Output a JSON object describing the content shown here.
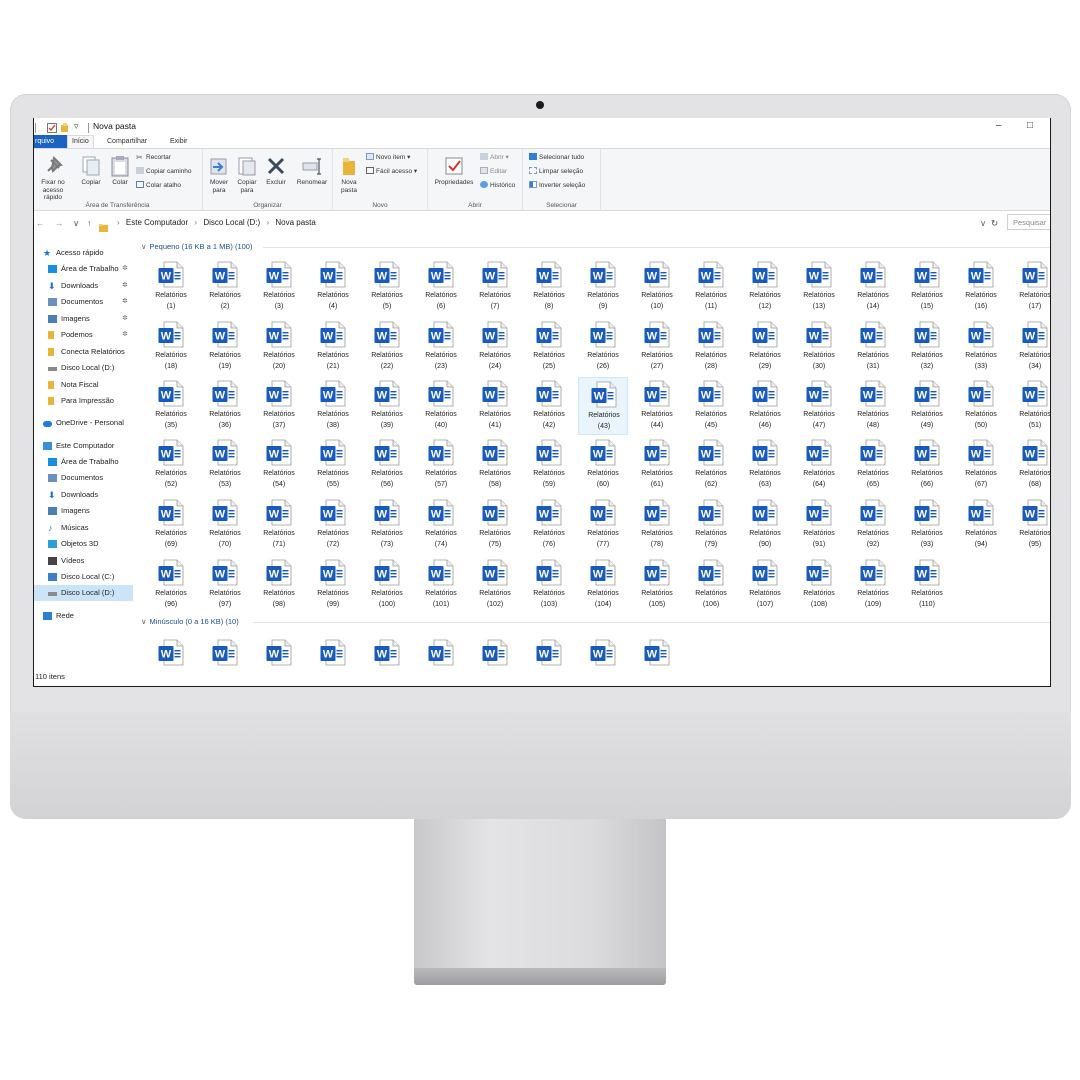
{
  "window": {
    "title": "Nova pasta",
    "minimize": "–",
    "maximize": "□"
  },
  "ribbon_tabs": [
    {
      "label": "rquivo"
    },
    {
      "label": "Início"
    },
    {
      "label": "Compartilhar"
    },
    {
      "label": "Exibir"
    }
  ],
  "ribbon": {
    "clipboard": {
      "pin_label": "Fixar no acesso rápido",
      "copy_label": "Copiar",
      "paste_label": "Colar",
      "cut_label": "Recortar",
      "copy_path_label": "Copiar caminho",
      "paste_shortcut_label": "Colar atalho",
      "group_label": "Área de Transferência"
    },
    "organize": {
      "move_label": "Mover para",
      "copy_label": "Copiar para",
      "delete_label": "Excluir",
      "rename_label": "Renomear",
      "group_label": "Organizar"
    },
    "new": {
      "new_folder_label": "Nova pasta",
      "new_item_label": "Novo item ▾",
      "easy_access_label": "Fácil acesso ▾",
      "group_label": "Novo"
    },
    "open": {
      "properties_label": "Propriedades",
      "open_label": "Abrir ▾",
      "edit_label": "Editar",
      "history_label": "Histórico",
      "group_label": "Abrir"
    },
    "select": {
      "select_all_label": "Selecionar tudo",
      "select_none_label": "Limpar seleção",
      "invert_label": "Inverter seleção",
      "group_label": "Selecionar"
    }
  },
  "address": {
    "crumbs": [
      "Este Computador",
      "Disco Local (D:)",
      "Nova pasta"
    ],
    "search_placeholder": "Pesquisar",
    "back": "←",
    "forward": "→",
    "recent": "∨",
    "up": "↑",
    "refresh": "↻",
    "dropdown": "∨"
  },
  "nav_pane": {
    "items": [
      {
        "label": "Acesso rápido",
        "icon": "star-icon",
        "color": "#1f6fd0",
        "pinned": false
      },
      {
        "label": "Área de Trabalho",
        "icon": "desktop-icon",
        "color": "#1a8fe0",
        "pinned": true
      },
      {
        "label": "Downloads",
        "icon": "download-icon",
        "color": "#1a6fd0",
        "pinned": true
      },
      {
        "label": "Documentos",
        "icon": "documents-icon",
        "color": "#6b8fbf",
        "pinned": true
      },
      {
        "label": "Imagens",
        "icon": "pictures-icon",
        "color": "#4a7fb5",
        "pinned": true
      },
      {
        "label": "Podemos",
        "icon": "folder-icon",
        "color": "#e8b43a",
        "pinned": true
      },
      {
        "label": "Conecta Relatórios",
        "icon": "folder-icon",
        "color": "#e8b43a",
        "pinned": false
      },
      {
        "label": "Disco Local (D:)",
        "icon": "drive-icon",
        "color": "#8a8a8a",
        "pinned": false
      },
      {
        "label": "Nota Fiscal",
        "icon": "folder-icon",
        "color": "#e8b43a",
        "pinned": false
      },
      {
        "label": "Para Impressão",
        "icon": "folder-icon",
        "color": "#e8b43a",
        "pinned": false
      },
      {
        "label": "OneDrive - Personal",
        "icon": "cloud-icon",
        "color": "#1a7fd8",
        "pinned": false
      },
      {
        "label": "Este Computador",
        "icon": "computer-icon",
        "color": "#3a8fd8",
        "pinned": false
      },
      {
        "label": "Área de Trabalho",
        "icon": "desktop-icon",
        "color": "#1a8fe0",
        "pinned": false
      },
      {
        "label": "Documentos",
        "icon": "documents-icon",
        "color": "#6b8fbf",
        "pinned": false
      },
      {
        "label": "Downloads",
        "icon": "download-icon",
        "color": "#1a6fd0",
        "pinned": false
      },
      {
        "label": "Imagens",
        "icon": "pictures-icon",
        "color": "#4a7fb5",
        "pinned": false
      },
      {
        "label": "Músicas",
        "icon": "music-icon",
        "color": "#2a6fc8",
        "pinned": false
      },
      {
        "label": "Objetos 3D",
        "icon": "cube-icon",
        "color": "#2aa0d8",
        "pinned": false
      },
      {
        "label": "Vídeos",
        "icon": "video-icon",
        "color": "#444444",
        "pinned": false
      },
      {
        "label": "Disco Local (C:)",
        "icon": "windows-drive-icon",
        "color": "#3a7fc8",
        "pinned": false
      },
      {
        "label": "Disco Local (D:)",
        "icon": "drive-icon",
        "color": "#8a8a8a",
        "pinned": false,
        "selected": true
      },
      {
        "label": "Rede",
        "icon": "network-icon",
        "color": "#2a7fd0",
        "pinned": false
      }
    ],
    "pin_glyph": "✲"
  },
  "status": {
    "item_count": "110 itens"
  },
  "groups": {
    "small": {
      "header": "Pequeno (16 KB a 1 MB) (100)",
      "files": [
        {
          "name": "Relatórios",
          "num": "(1)"
        },
        {
          "name": "Relatórios",
          "num": "(2)"
        },
        {
          "name": "Relatórios",
          "num": "(3)"
        },
        {
          "name": "Relatórios",
          "num": "(4)"
        },
        {
          "name": "Relatórios",
          "num": "(5)"
        },
        {
          "name": "Relatórios",
          "num": "(6)"
        },
        {
          "name": "Relatórios",
          "num": "(7)"
        },
        {
          "name": "Relatórios",
          "num": "(8)"
        },
        {
          "name": "Relatórios",
          "num": "(9)"
        },
        {
          "name": "Relatórios",
          "num": "(10)"
        },
        {
          "name": "Relatórios",
          "num": "(11)"
        },
        {
          "name": "Relatórios",
          "num": "(12)"
        },
        {
          "name": "Relatórios",
          "num": "(13)"
        },
        {
          "name": "Relatórios",
          "num": "(14)"
        },
        {
          "name": "Relatórios",
          "num": "(15)"
        },
        {
          "name": "Relatórios",
          "num": "(16)"
        },
        {
          "name": "Relatórios",
          "num": "(17)"
        },
        {
          "name": "Relatórios",
          "num": "(18)"
        },
        {
          "name": "Relatórios",
          "num": "(19)"
        },
        {
          "name": "Relatórios",
          "num": "(20)"
        },
        {
          "name": "Relatórios",
          "num": "(21)"
        },
        {
          "name": "Relatórios",
          "num": "(22)"
        },
        {
          "name": "Relatórios",
          "num": "(23)"
        },
        {
          "name": "Relatórios",
          "num": "(24)"
        },
        {
          "name": "Relatórios",
          "num": "(25)"
        },
        {
          "name": "Relatórios",
          "num": "(26)"
        },
        {
          "name": "Relatórios",
          "num": "(27)"
        },
        {
          "name": "Relatórios",
          "num": "(28)"
        },
        {
          "name": "Relatórios",
          "num": "(29)"
        },
        {
          "name": "Relatórios",
          "num": "(30)"
        },
        {
          "name": "Relatórios",
          "num": "(31)"
        },
        {
          "name": "Relatórios",
          "num": "(32)"
        },
        {
          "name": "Relatórios",
          "num": "(33)"
        },
        {
          "name": "Relatórios",
          "num": "(34)"
        },
        {
          "name": "Relatórios",
          "num": "(35)"
        },
        {
          "name": "Relatórios",
          "num": "(36)"
        },
        {
          "name": "Relatórios",
          "num": "(37)"
        },
        {
          "name": "Relatórios",
          "num": "(38)"
        },
        {
          "name": "Relatórios",
          "num": "(39)"
        },
        {
          "name": "Relatórios",
          "num": "(40)"
        },
        {
          "name": "Relatórios",
          "num": "(41)"
        },
        {
          "name": "Relatórios",
          "num": "(42)"
        },
        {
          "name": "Relatórios",
          "num": "(43)",
          "hover": true
        },
        {
          "name": "Relatórios",
          "num": "(44)"
        },
        {
          "name": "Relatórios",
          "num": "(45)"
        },
        {
          "name": "Relatórios",
          "num": "(46)"
        },
        {
          "name": "Relatórios",
          "num": "(47)"
        },
        {
          "name": "Relatórios",
          "num": "(48)"
        },
        {
          "name": "Relatórios",
          "num": "(49)"
        },
        {
          "name": "Relatórios",
          "num": "(50)"
        },
        {
          "name": "Relatórios",
          "num": "(51)"
        },
        {
          "name": "Relatórios",
          "num": "(52)"
        },
        {
          "name": "Relatórios",
          "num": "(53)"
        },
        {
          "name": "Relatórios",
          "num": "(54)"
        },
        {
          "name": "Relatórios",
          "num": "(55)"
        },
        {
          "name": "Relatórios",
          "num": "(56)"
        },
        {
          "name": "Relatórios",
          "num": "(57)"
        },
        {
          "name": "Relatórios",
          "num": "(58)"
        },
        {
          "name": "Relatórios",
          "num": "(59)"
        },
        {
          "name": "Relatórios",
          "num": "(60)"
        },
        {
          "name": "Relatórios",
          "num": "(61)"
        },
        {
          "name": "Relatórios",
          "num": "(62)"
        },
        {
          "name": "Relatórios",
          "num": "(63)"
        },
        {
          "name": "Relatórios",
          "num": "(64)"
        },
        {
          "name": "Relatórios",
          "num": "(65)"
        },
        {
          "name": "Relatórios",
          "num": "(66)"
        },
        {
          "name": "Relatórios",
          "num": "(67)"
        },
        {
          "name": "Relatórios",
          "num": "(68)"
        },
        {
          "name": "Relatórios",
          "num": "(69)"
        },
        {
          "name": "Relatórios",
          "num": "(70)"
        },
        {
          "name": "Relatórios",
          "num": "(71)"
        },
        {
          "name": "Relatórios",
          "num": "(72)"
        },
        {
          "name": "Relatórios",
          "num": "(73)"
        },
        {
          "name": "Relatórios",
          "num": "(74)"
        },
        {
          "name": "Relatórios",
          "num": "(75)"
        },
        {
          "name": "Relatórios",
          "num": "(76)"
        },
        {
          "name": "Relatórios",
          "num": "(77)"
        },
        {
          "name": "Relatórios",
          "num": "(78)"
        },
        {
          "name": "Relatórios",
          "num": "(79)"
        },
        {
          "name": "Relatórios",
          "num": "(90)"
        },
        {
          "name": "Relatórios",
          "num": "(91)"
        },
        {
          "name": "Relatórios",
          "num": "(92)"
        },
        {
          "name": "Relatórios",
          "num": "(93)"
        },
        {
          "name": "Relatórios",
          "num": "(94)"
        },
        {
          "name": "Relatórios",
          "num": "(95)"
        },
        {
          "name": "Relatórios",
          "num": "(96)"
        },
        {
          "name": "Relatórios",
          "num": "(97)"
        },
        {
          "name": "Relatórios",
          "num": "(98)"
        },
        {
          "name": "Relatórios",
          "num": "(99)"
        },
        {
          "name": "Relatórios",
          "num": "(100)"
        },
        {
          "name": "Relatórios",
          "num": "(101)"
        },
        {
          "name": "Relatórios",
          "num": "(102)"
        },
        {
          "name": "Relatórios",
          "num": "(103)"
        },
        {
          "name": "Relatórios",
          "num": "(104)"
        },
        {
          "name": "Relatórios",
          "num": "(105)"
        },
        {
          "name": "Relatórios",
          "num": "(106)"
        },
        {
          "name": "Relatórios",
          "num": "(107)"
        },
        {
          "name": "Relatórios",
          "num": "(108)"
        },
        {
          "name": "Relatórios",
          "num": "(109)"
        },
        {
          "name": "Relatórios",
          "num": "(110)"
        }
      ]
    },
    "tiny": {
      "header": "Minúsculo (0 a 16 KB) (10)",
      "files": [
        {
          "name": "",
          "num": ""
        },
        {
          "name": "",
          "num": ""
        },
        {
          "name": "",
          "num": ""
        },
        {
          "name": "",
          "num": ""
        },
        {
          "name": "",
          "num": ""
        },
        {
          "name": "",
          "num": ""
        },
        {
          "name": "",
          "num": ""
        },
        {
          "name": "",
          "num": ""
        },
        {
          "name": "",
          "num": ""
        },
        {
          "name": "",
          "num": ""
        }
      ]
    }
  },
  "colors": {
    "word_blue": "#185abd",
    "file_tab": "#1a63c2",
    "group_header": "#1e4e8c",
    "selected_nav": "#cce4f7"
  }
}
